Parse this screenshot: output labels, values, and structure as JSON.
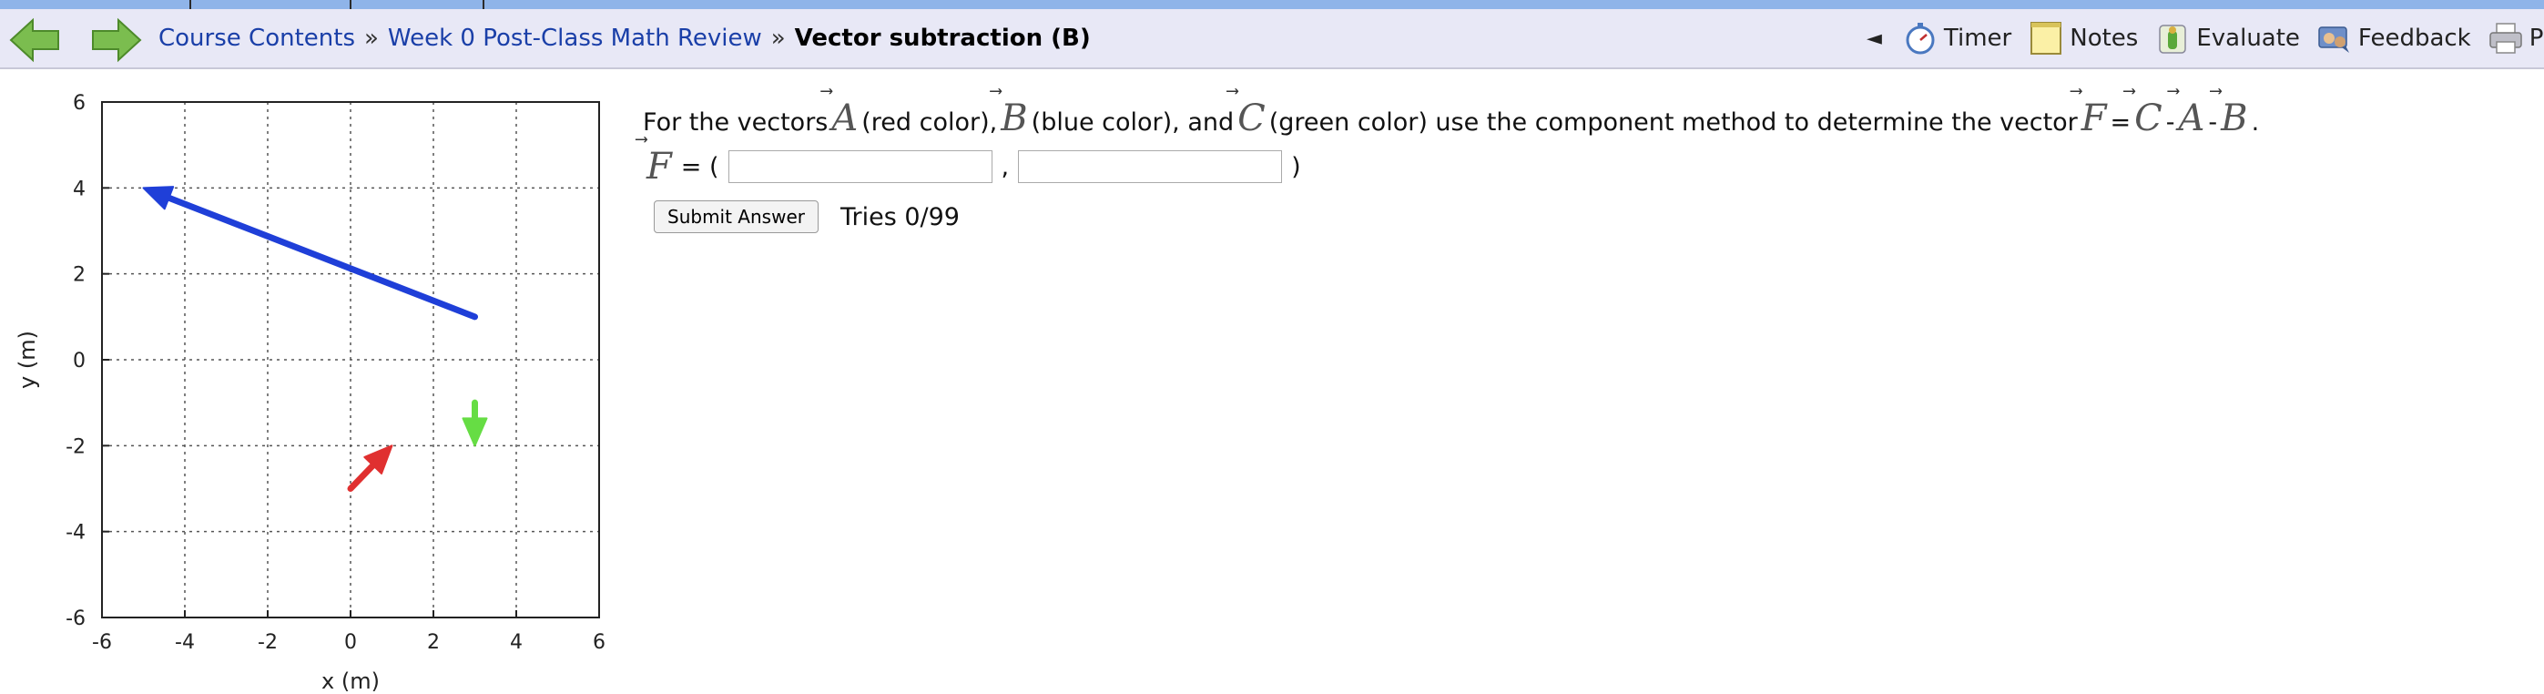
{
  "nav": {
    "breadcrumbs": [
      {
        "label": "Course Contents",
        "link": true
      },
      {
        "label": "Week 0 Post-Class Math Review",
        "link": true
      },
      {
        "label": "Vector subtraction (B)",
        "link": false
      }
    ],
    "separator": "»",
    "tools": [
      {
        "label": "Timer",
        "icon": "stopwatch-icon"
      },
      {
        "label": "Notes",
        "icon": "notepad-icon"
      },
      {
        "label": "Evaluate",
        "icon": "evaluate-icon"
      },
      {
        "label": "Feedback",
        "icon": "feedback-icon"
      },
      {
        "label": "Print",
        "icon": "printer-icon"
      }
    ],
    "prev_glyph": "◄"
  },
  "problem": {
    "text1": "For the vectors",
    "text2": "(red color),",
    "text3": "(blue color), and",
    "text4": "(green color) use the component method to determine the vector",
    "eq": "=",
    "minus": "-",
    "period": ".",
    "vecA": "A",
    "vecB": "B",
    "vecC": "C",
    "vecF": "F",
    "arrow": "⃗",
    "answer_prefix": "= (",
    "answer_comma": ",",
    "answer_suffix": ")",
    "input1_value": "",
    "input2_value": "",
    "submit_label": "Submit Answer",
    "tries": "Tries 0/99"
  },
  "chart_data": {
    "type": "vector-plot",
    "xlabel": "x (m)",
    "ylabel": "y (m)",
    "xlim": [
      -6,
      6
    ],
    "ylim": [
      -6,
      6
    ],
    "xticks": [
      -6,
      -4,
      -2,
      0,
      2,
      4,
      6
    ],
    "yticks": [
      -6,
      -4,
      -2,
      0,
      2,
      4,
      6
    ],
    "grid": true,
    "vectors": [
      {
        "name": "A",
        "color": "#e03030",
        "tail": [
          0,
          -3
        ],
        "head": [
          1,
          -2
        ]
      },
      {
        "name": "B",
        "color": "#1f3fd8",
        "tail": [
          3,
          1
        ],
        "head": [
          -5,
          4
        ]
      },
      {
        "name": "C",
        "color": "#66dd44",
        "tail": [
          3,
          -1
        ],
        "head": [
          3,
          -2
        ]
      }
    ]
  },
  "colors": {
    "topstrip": "#8fb4e9",
    "navbar": "#e8e8f6",
    "link": "#1a3fa8",
    "nav_arrows": "#6ab04c"
  }
}
